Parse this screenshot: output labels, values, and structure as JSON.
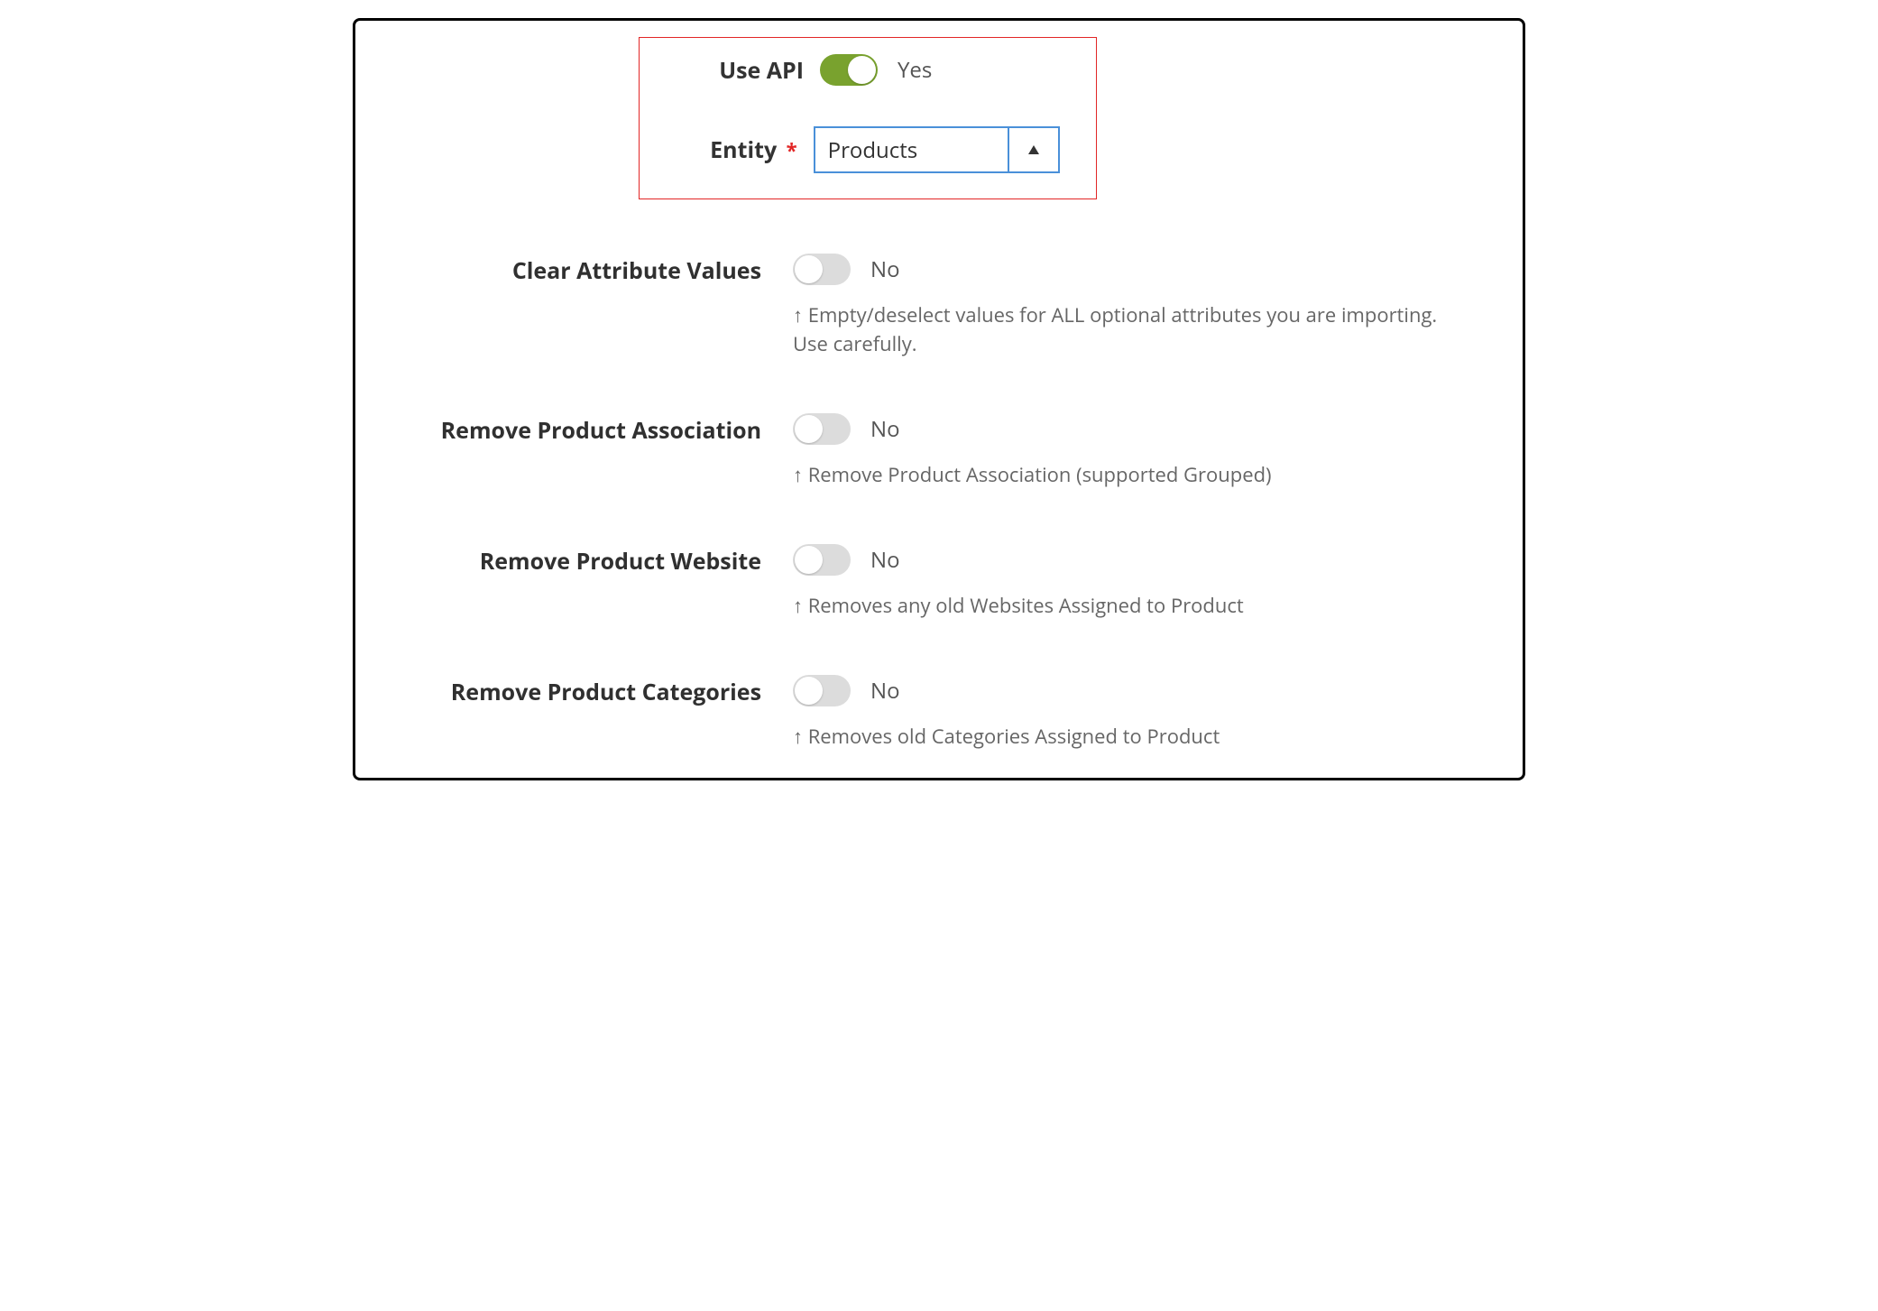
{
  "highlighted": {
    "use_api": {
      "label": "Use API",
      "on": true,
      "state_text": "Yes"
    },
    "entity": {
      "label": "Entity",
      "required_marker": "*",
      "value": "Products"
    }
  },
  "settings": [
    {
      "key": "clear-attribute-values",
      "label": "Clear Attribute Values",
      "on": false,
      "state_text": "No",
      "helper": "↑ Empty/deselect values for ALL optional attributes you are importing. Use carefully."
    },
    {
      "key": "remove-product-association",
      "label": "Remove Product Association",
      "on": false,
      "state_text": "No",
      "helper": "↑ Remove Product Association (supported Grouped)"
    },
    {
      "key": "remove-product-website",
      "label": "Remove Product Website",
      "on": false,
      "state_text": "No",
      "helper": "↑ Removes any old Websites Assigned to Product"
    },
    {
      "key": "remove-product-categories",
      "label": "Remove Product Categories",
      "on": false,
      "state_text": "No",
      "helper": "↑ Removes old Categories Assigned to Product"
    }
  ]
}
